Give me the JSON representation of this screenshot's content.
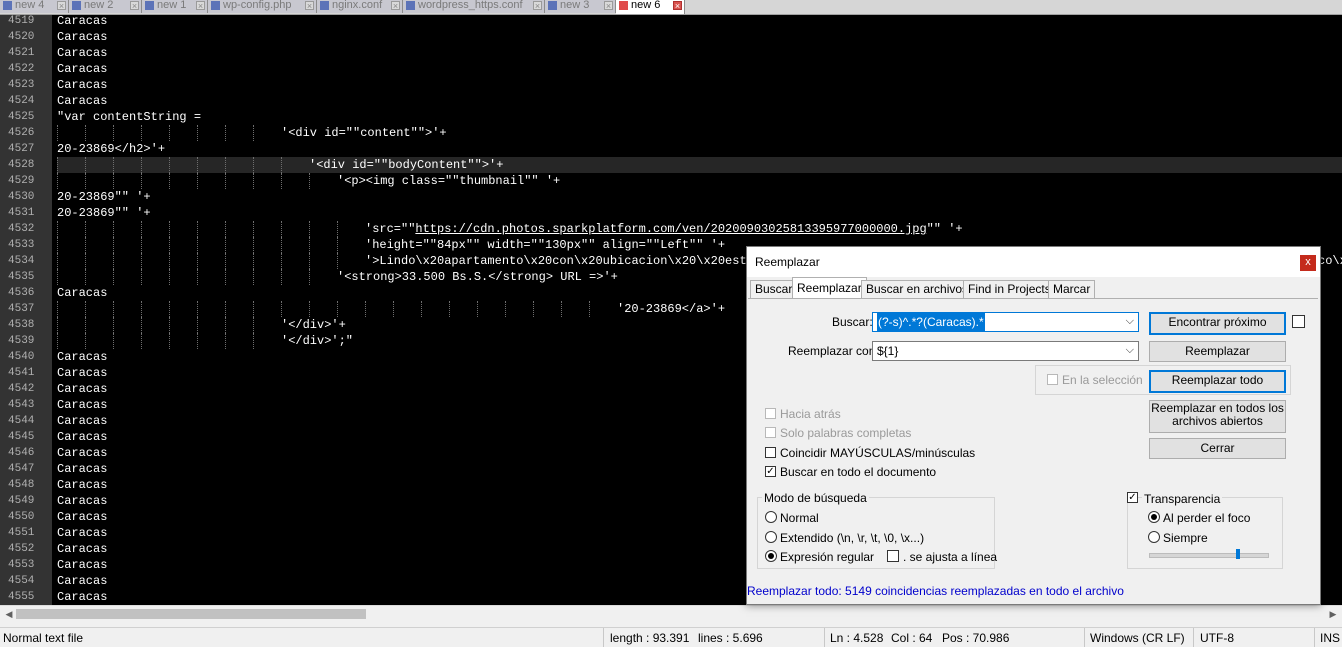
{
  "tabs": [
    {
      "label": "new 4",
      "active": false
    },
    {
      "label": "new 2",
      "active": false
    },
    {
      "label": "new 1",
      "active": false
    },
    {
      "label": "wp-config.php",
      "active": false
    },
    {
      "label": "nginx.conf",
      "active": false
    },
    {
      "label": "wordpress_https.conf",
      "active": false
    },
    {
      "label": "new 3",
      "active": false
    },
    {
      "label": "new 6",
      "active": true
    }
  ],
  "editor": {
    "current_line": "4528",
    "lines": [
      {
        "n": "4519",
        "text": "Caracas"
      },
      {
        "n": "4520",
        "text": "Caracas"
      },
      {
        "n": "4521",
        "text": "Caracas"
      },
      {
        "n": "4522",
        "text": "Caracas"
      },
      {
        "n": "4523",
        "text": "Caracas"
      },
      {
        "n": "4524",
        "text": "Caracas"
      },
      {
        "n": "4525",
        "text": "\"var contentString ="
      },
      {
        "n": "4526",
        "text": "'<div id=\"\"content\"\">'+"
      },
      {
        "n": "4527",
        "text": "20-23869</h2>'+"
      },
      {
        "n": "4528",
        "text": "'<div id=\"\"bodyContent\"\">'+"
      },
      {
        "n": "4529",
        "text": "'<p><img class=\"\"thumbnail\"\" '+"
      },
      {
        "n": "4530",
        "text": "20-23869\"\" '+"
      },
      {
        "n": "4531",
        "text": "20-23869\"\" '+"
      },
      {
        "n": "4532",
        "text": "'src=\"\"",
        "link": "https://cdn.photos.sparkplatform.com/ven/20200903025813395977000000.jpg",
        "after": "\"\" '+"
      },
      {
        "n": "4533",
        "text": "'height=\"\"84px\"\" width=\"\"130px\"\" align=\"\"Left\"\" '+"
      },
      {
        "n": "4534",
        "text": "'>Lindo\\x20apartamento\\x20con\\x20ubicacion\\x20\\x20estra",
        "tail": "co\\x"
      },
      {
        "n": "4535",
        "text": "'<strong>33.500 Bs.S.</strong> URL =>'+"
      },
      {
        "n": "4536",
        "text": "Caracas"
      },
      {
        "n": "4537",
        "text": "'20-23869</a>'+"
      },
      {
        "n": "4538",
        "text": "'</div>'+"
      },
      {
        "n": "4539",
        "text": "'</div>';\""
      },
      {
        "n": "4540",
        "text": "Caracas"
      },
      {
        "n": "4541",
        "text": "Caracas"
      },
      {
        "n": "4542",
        "text": "Caracas"
      },
      {
        "n": "4543",
        "text": "Caracas"
      },
      {
        "n": "4544",
        "text": "Caracas"
      },
      {
        "n": "4545",
        "text": "Caracas"
      },
      {
        "n": "4546",
        "text": "Caracas"
      },
      {
        "n": "4547",
        "text": "Caracas"
      },
      {
        "n": "4548",
        "text": "Caracas"
      },
      {
        "n": "4549",
        "text": "Caracas"
      },
      {
        "n": "4550",
        "text": "Caracas"
      },
      {
        "n": "4551",
        "text": "Caracas"
      },
      {
        "n": "4552",
        "text": "Caracas"
      },
      {
        "n": "4553",
        "text": "Caracas"
      },
      {
        "n": "4554",
        "text": "Caracas"
      },
      {
        "n": "4555",
        "text": "Caracas"
      }
    ]
  },
  "status": {
    "file_type": "Normal text file",
    "length": "length : 93.391",
    "lines": "lines : 5.696",
    "ln": "Ln : 4.528",
    "col": "Col : 64",
    "pos": "Pos : 70.986",
    "eol": "Windows (CR LF)",
    "encoding": "UTF-8",
    "mode": "INS"
  },
  "dialog": {
    "title": "Reemplazar",
    "close": "x",
    "tabs": [
      "Buscar",
      "Reemplazar",
      "Buscar en archivos",
      "Find in Projects",
      "Marcar"
    ],
    "active_tab": "Reemplazar",
    "find_label": "Buscar:",
    "find_value": "(?-s)^.*?(Caracas).*",
    "replace_label": "Reemplazar con:",
    "replace_value": "${1}",
    "in_selection": "En la selección",
    "buttons": {
      "find_next": "Encontrar próximo",
      "replace": "Reemplazar",
      "replace_all": "Reemplazar todo",
      "replace_all_open_1": "Reemplazar en todos los",
      "replace_all_open_2": "archivos abiertos",
      "close": "Cerrar"
    },
    "options": {
      "backward": "Hacia atrás",
      "whole_word": "Solo palabras completas",
      "match_case": "Coincidir MAYÚSCULAS/minúsculas",
      "wrap": "Buscar en todo el documento"
    },
    "search_mode": {
      "title": "Modo de búsqueda",
      "normal": "Normal",
      "extended": "Extendido (\\n, \\r, \\t, \\0, \\x...)",
      "regex": "Expresión regular",
      "dot_newline": ". se ajusta a línea",
      "selected": "regex"
    },
    "transparency": {
      "title": "Transparencia",
      "on_lose_focus": "Al perder el foco",
      "always": "Siempre",
      "selected": "on_lose_focus",
      "level": 0.75
    },
    "status_message": "Reemplazar todo: 5149 coincidencias reemplazadas en todo el archivo"
  }
}
